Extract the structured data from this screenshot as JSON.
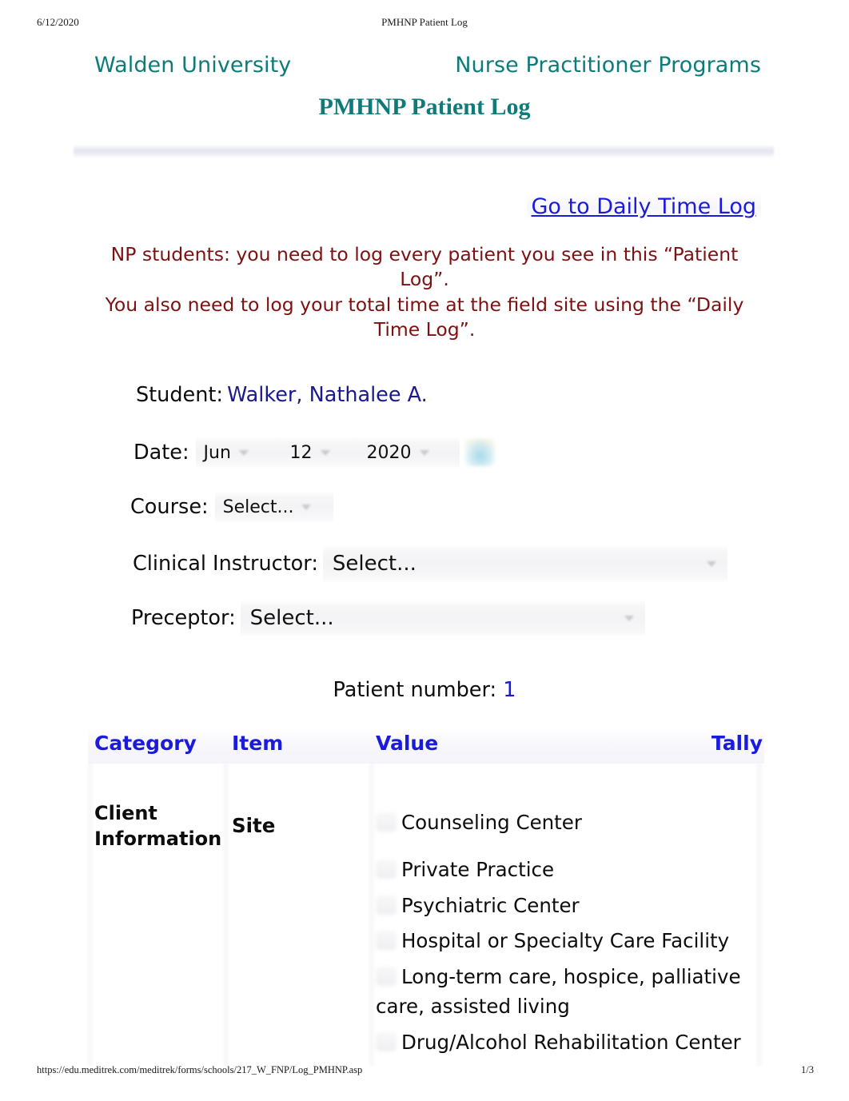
{
  "print_header": {
    "date": "6/12/2020",
    "title": "PMHNP Patient Log"
  },
  "print_footer": {
    "url": "https://edu.meditrek.com/meditrek/forms/schools/217_W_FNP/Log_PMHNP.asp",
    "page": "1/3"
  },
  "branding": {
    "university": "Walden University",
    "program": "Nurse Practitioner Programs",
    "doc_title": "PMHNP Patient Log",
    "teal": "#0e7b7b"
  },
  "links": {
    "daily_time_log": "Go to Daily Time Log",
    "link_color": "#1b1bdd"
  },
  "notice": {
    "line1": "NP students: you need to log every patient you see in this “Patient Log”.",
    "line2": "You also need to log your total time at the field site using the “Daily Time Log”.",
    "color": "#7d1111"
  },
  "form": {
    "student": {
      "label": "Student:",
      "value": "Walker, Nathalee A."
    },
    "date": {
      "label": "Date:",
      "month": "Jun",
      "day": "12",
      "year": "2020",
      "calendar_icon": "calendar-icon"
    },
    "course": {
      "label": "Course:",
      "value": "Select..."
    },
    "clinical_instructor": {
      "label": "Clinical Instructor:",
      "value": "Select..."
    },
    "preceptor": {
      "label": "Preceptor:",
      "value": "Select..."
    }
  },
  "patient": {
    "label": "Patient number:",
    "number": "1",
    "number_color": "#1b1bc8"
  },
  "table": {
    "headers": {
      "category": "Category",
      "item": "Item",
      "value": "Value",
      "tally": "Tally"
    },
    "header_color": "#1b1bdd",
    "rows": [
      {
        "category": "Client Information",
        "item": "Site",
        "tally": "",
        "options": [
          "Counseling Center",
          "Private Practice",
          "Psychiatric Center",
          "Hospital or Specialty Care Facility",
          "Long-term care, hospice, palliative care, assisted living",
          "Drug/Alcohol Rehabilitation Center"
        ]
      }
    ]
  }
}
